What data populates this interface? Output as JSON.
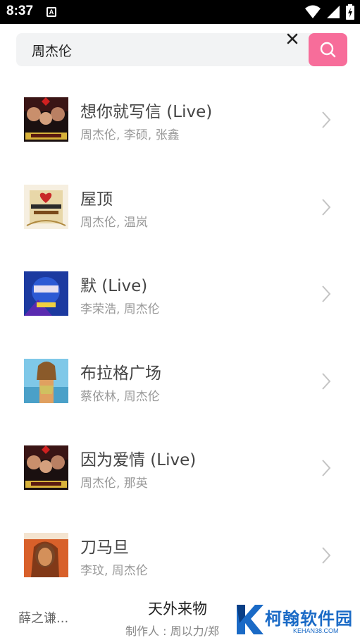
{
  "status_bar": {
    "time": "8:37",
    "notification_letter": "A"
  },
  "search": {
    "query": "周杰伦"
  },
  "songs": [
    {
      "title": "想你就写信 (Live)",
      "artists": "周杰伦, 李硕, 张鑫"
    },
    {
      "title": "屋顶",
      "artists": "周杰伦, 温岚"
    },
    {
      "title": "默 (Live)",
      "artists": "李荣浩, 周杰伦"
    },
    {
      "title": "布拉格广场",
      "artists": "蔡依林, 周杰伦"
    },
    {
      "title": "因为爱情 (Live)",
      "artists": "周杰伦, 那英"
    },
    {
      "title": "刀马旦",
      "artists": "李玟, 周杰伦"
    }
  ],
  "player": {
    "left_text": "薛之谦...",
    "title": "天外来物",
    "subtitle": "制作人 : 周以力/郑"
  },
  "watermark": {
    "text": "柯翰软件园",
    "url": "KEHAN38.COM"
  },
  "colors": {
    "accent": "#f76d9a",
    "search_bg": "#f2f3f4",
    "watermark": "#1a6ac6"
  }
}
